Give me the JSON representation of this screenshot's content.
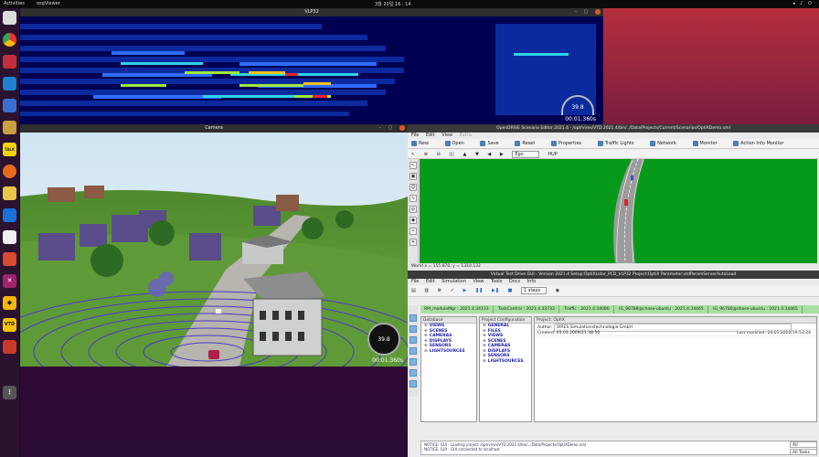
{
  "topbar": {
    "activities": "Activities",
    "app": "osgViewer",
    "clock": "3월 20일 16 : 14"
  },
  "dock": {
    "icons": [
      "files-icon",
      "chrome-icon",
      "terminal-icon",
      "vscode-icon",
      "editor-icon",
      "archive-icon",
      "talk-icon",
      "firefox-icon",
      "app-icon",
      "wireshark-icon",
      "document-icon",
      "slides-icon",
      "x-icon",
      "warning-icon",
      "vtd-icon",
      "trash-icon",
      "grid-icon"
    ],
    "chat_label": "TALK",
    "vtd_label": "VTD"
  },
  "vlp_window": {
    "title": "VLP32",
    "speed": "39.8",
    "timecode": "00:01.360s"
  },
  "camera_window": {
    "title": "Camera",
    "speed": "39.8",
    "timecode": "00:01.360s"
  },
  "scenario_editor": {
    "title": "OpenDRIVE Scenario Editor 2021.4 - /opt/vires/VTD.2021.4/bin/../Data/Projects/Current/Scenarios/OptiXDemo.xml",
    "menu": [
      "File",
      "Edit",
      "View",
      "Extra"
    ],
    "toolbar": [
      "New",
      "Open",
      "Save",
      "Reset",
      "Properties",
      "Traffic Lights",
      "Network",
      "Monitor",
      "Action Info Monitor"
    ],
    "toolbar2": [
      "Ego",
      "HUP"
    ],
    "status": "World x = 155.870, y = 1310.132"
  },
  "vtd_gui": {
    "title": "Virtual Test Drive GUI - Version 2021.4  Setup:OptiXLidar_PCD_VLP32  Project:OptiX  Parameter:vtdParamServerAutoLoad",
    "menu": [
      "File",
      "Edit",
      "Simulation",
      "View",
      "Tools",
      "Docs",
      "Info"
    ],
    "steps": "1 steps",
    "tabs": [
      "RM_moduleMgr : 2021.4.34133",
      "TaskControl : 2021.4.33733",
      "Traffic : 2021.4.34080",
      "IG_96788@chase-ubuntu : 2021.4.34465",
      "IG_96780@chase-ubuntu : 2021.4.34465"
    ],
    "database": {
      "header": "Database",
      "items": [
        "VIEWS",
        "SCENES",
        "CAMERAS",
        "DISPLAYS",
        "SENSORS",
        "LIGHTSOURCES"
      ]
    },
    "project_config": {
      "header": "Project Configuration",
      "items": [
        "GENERAL",
        "FILES",
        "VIEWS",
        "SCENES",
        "CAMERAS",
        "DISPLAYS",
        "SENSORS",
        "LIGHTSOURCES"
      ]
    },
    "project": {
      "header": "Project: OptiX",
      "author_label": "Author:",
      "author": "VIRES Simulationstechnologie GmbH",
      "created_label": "Created:",
      "created": "03.03.2009/21:38:50",
      "modified_label": "Last modified:",
      "modified": "26.05.2022/19:53:24"
    },
    "log": [
      "NOTICE:  GUI - Loading project /opt/vires/VTD.2021.4/bin/../Data/Projects/OptiXDemo.xml",
      "NOTICE:  GUI - GUI connected to localhost"
    ],
    "side": [
      "All",
      "All Tasks"
    ]
  }
}
